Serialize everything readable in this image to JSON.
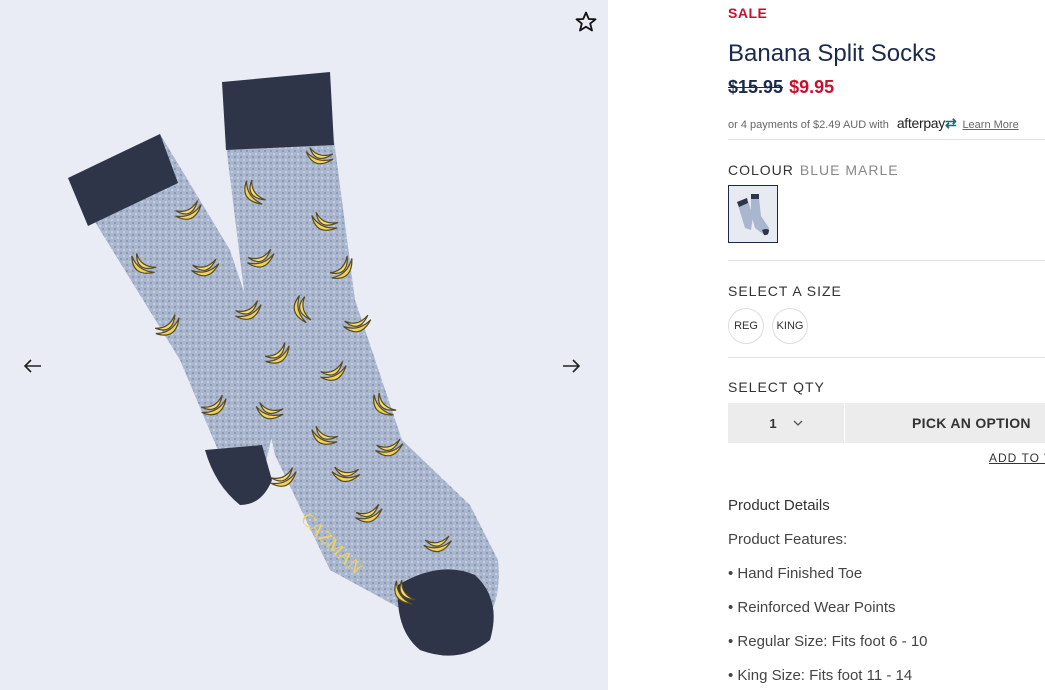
{
  "gallery": {
    "favorite_icon": "star-outline-icon",
    "prev_icon": "arrow-left-icon",
    "next_icon": "arrow-right-icon",
    "brand_text": "CAZMAN"
  },
  "product": {
    "badge": "SALE",
    "title": "Banana Split Socks",
    "price_original": "$15.95",
    "price_sale": "$9.95",
    "afterpay": {
      "text": "or 4 payments of $2.49 AUD with",
      "logo_text": "afterpay",
      "learn_more": "Learn More"
    },
    "colour": {
      "label": "COLOUR",
      "value": "BLUE MARLE"
    },
    "size": {
      "label": "SELECT A SIZE",
      "options": [
        "REG",
        "KING"
      ]
    },
    "qty": {
      "label": "SELECT QTY",
      "value": "1"
    },
    "pick_option": "PICK AN OPTION",
    "add_to_wishlist": "ADD TO WISHLIST",
    "details": {
      "heading": "Product Details",
      "lines": [
        "Product Features:",
        "• Hand Finished Toe",
        "• Reinforced Wear Points",
        "• Regular Size: Fits foot 6 - 10",
        "• King Size: Fits foot 11 - 14"
      ]
    }
  },
  "colors": {
    "sale_red": "#c8102e",
    "navy": "#1b2a4a",
    "sock_grey": "#a9b6cd",
    "banana_yellow": "#f0d35a"
  }
}
